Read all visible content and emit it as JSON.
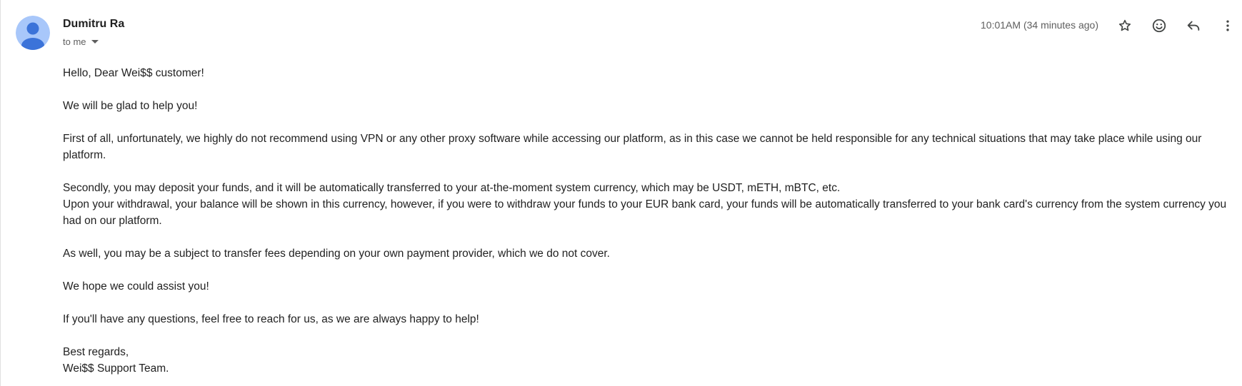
{
  "sender": {
    "name": "Dumitru Ra",
    "recipient_label": "to me"
  },
  "header": {
    "timestamp": "10:01AM (34 minutes ago)"
  },
  "colors": {
    "avatar_bg": "#a8c7fa",
    "avatar_fg": "#3b73d9"
  },
  "icons": {
    "star": "star-icon",
    "emoji": "emoji-icon",
    "reply": "reply-icon",
    "more": "more-vertical-icon"
  },
  "message": {
    "greeting": "Hello, Dear Wei$$ customer!",
    "p1": "We will be glad to help you!",
    "p2": "First of all, unfortunately, we highly do not recommend using VPN or any other proxy software while accessing our platform, as in this case we cannot be held responsible for any technical situations that may take place while using our platform.",
    "p3a": "Secondly, you may deposit your funds, and it will be automatically transferred to your at-the-moment system currency, which may be USDT, mETH, mBTC, etc.",
    "p3b": "Upon your withdrawal, your balance will be shown in this currency, however, if you were to withdraw your funds to your EUR bank card, your funds will be automatically transferred to your bank card's currency from the system currency you had on our platform.",
    "p4": "As well, you may be a subject to transfer fees depending on your own payment provider, which we do not cover.",
    "p5": "We hope we could assist you!",
    "p6": "If you'll have any questions, feel free to reach for us, as we are always happy to help!",
    "signoff": "Best regards,",
    "signature": "Wei$$ Support Team."
  }
}
